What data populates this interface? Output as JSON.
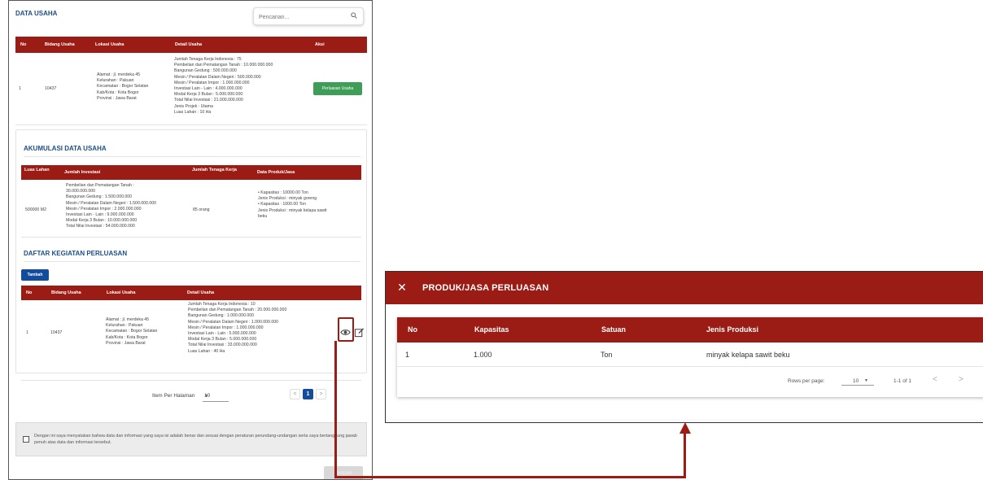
{
  "data_usaha": {
    "title": "DATA USAHA",
    "search_placeholder": "Pencarian...",
    "headers": [
      "No",
      "Bidang Usaha",
      "Lokasi Usaha",
      "Detail Usaha",
      "Aksi"
    ],
    "row": {
      "no": "1",
      "bidang": "10437",
      "lokasi": "Alamat : jl. merdeka 45\nKelurahan : Pakuan\nKecamatan : Bogor Selatan\nKab/Kota : Kota Bogor\nProvinsi : Jawa Barat",
      "detail": "Jumlah Tenaga Kerja Indonesia : 75\nPembelian dan Pematangan Tanah : 10.000.000.000\nBangunan Gedung : 500.000.000\nMesin / Peralatan Dalam Negeri : 500.000.000\nMesin / Peralatan Impor : 1.000.000.000\nInvestasi Lain - Lain : 4.000.000.000\nModal Kerja 3 Bulan : 5.000.000.000\nTotal Nilai Investasi : 21.000.000.000\nJenis Projek : Utama\nLuas Lahan : 10  Ha",
      "action_label": "Perluasan Usaha"
    }
  },
  "akumulasi": {
    "title": "AKUMULASI DATA USAHA",
    "headers": [
      "Luas Lahan",
      "Jumlah Investasi",
      "Jumlah Tenaga Kerja",
      "Data Produk/Jasa"
    ],
    "row": {
      "luas": "500000 M2",
      "investasi": "Pembelian dan Pematangan Tanah :\n30.000.000.000\nBangunan Gedung : 1.500.000.000\nMesin / Peralatan Dalam Negeri : 1.500.000.000\nMesin / Peralatan Impor : 2.000.000.000\nInvestasi Lain - Lain : 9.000.000.000\nModal Kerja 3 Bulan : 10.000.000.000\nTotal Nilai Investasi : 54.000.000.000",
      "tenaga": "85 orang",
      "produk": "•  Kapasitas : 10000.00 Ton\n    Jenis Produksi : minyak goreng\n•  Kapasitas : 1000.00 Ton\n    Jenis Produksi : minyak kelapa sawit\n    beku"
    }
  },
  "kegiatan": {
    "title": "DAFTAR KEGIATAN PERLUASAN",
    "add_label": "Tambah",
    "headers": [
      "No",
      "Bidang Usaha",
      "Lokasi Usaha",
      "Detail Usaha"
    ],
    "row": {
      "no": "1",
      "bidang": "10437",
      "lokasi": "Alamat : jl. merdeka 45\nKelurahan : Pakuan\nKecamatan : Bogor Selatan\nKab/Kota : Kota Bogor\nProvinsi : Jawa Barat",
      "detail": "Jumlah Tenaga Kerja Indonesia : 10\nPembelian dan Pematangan Tanah : 20.000.000.000\nBangunan Gedung : 1.000.000.000\nMesin / Peralatan Dalam Negeri : 1.000.000.000\nMesin / Peralatan Impor : 1.000.000.000\nInvestasi Lain - Lain : 5.000.000.000\nModal Kerja 3 Bulan : 5.000.000.000\nTotal Nilai Investasi : 33.000.000.000\nLuas Lahan : 40  Ha"
    },
    "icons": {
      "view": "eye-icon",
      "edit": "edit-icon"
    }
  },
  "pagination": {
    "label": "Item Per Halaman",
    "per_page": "10",
    "prev": "<",
    "current": "1",
    "next": ">"
  },
  "consent": {
    "text": "Dengan ini saya menyatakan bahwa data dan informasi yang saya isi adalah benar dan sesuai dengan peraturan perundang-undangan serta saya bertanggung jawab penuh atas data dan informasi tersebut."
  },
  "submit_label": "Simpan",
  "modal": {
    "close": "✕",
    "title": "PRODUK/JASA PERLUASAN",
    "headers": [
      "No",
      "Kapasitas",
      "Satuan",
      "Jenis Produksi"
    ],
    "row": {
      "no": "1",
      "kapasitas": "1.000",
      "satuan": "Ton",
      "jenis": "minyak kelapa sawit beku"
    },
    "footer": {
      "rows_label": "Rows per page:",
      "rows_value": "10",
      "range": "1-1 of 1",
      "prev": "<",
      "next": ">"
    }
  },
  "colors": {
    "header": "#9b1c14",
    "primary": "#124c9c",
    "success": "#3e9e58",
    "title": "#1b4f8a"
  }
}
